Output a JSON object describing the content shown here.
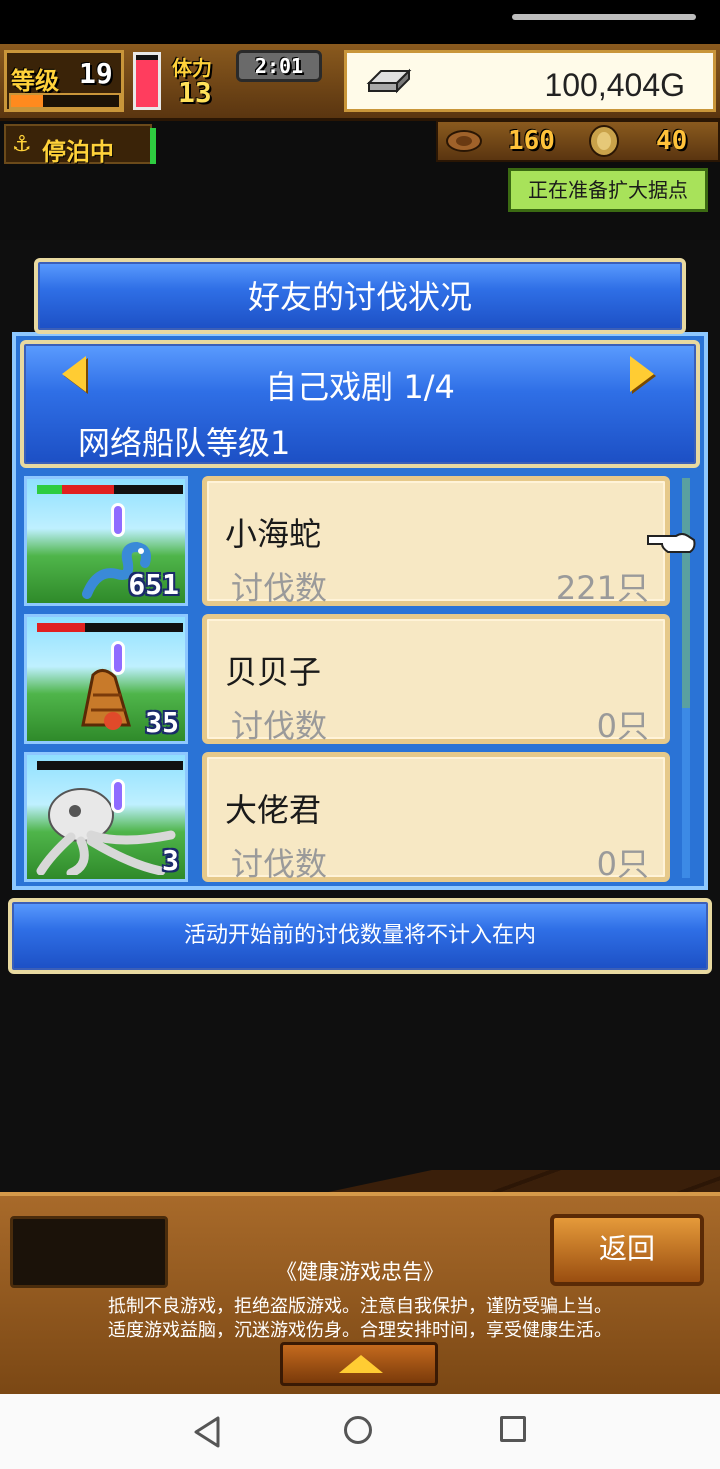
{
  "hud": {
    "level_label": "等级",
    "level_value": "19",
    "exp_fraction": 0.3,
    "stamina_label": "体力",
    "stamina_value": "13",
    "stamina_fraction": 0.9,
    "clock": "2:01",
    "gold": "100,404G"
  },
  "status": {
    "port_label": "停泊中",
    "food": "160",
    "resource2": "40",
    "expand_notice": "正在准备扩大据点"
  },
  "panel": {
    "title": "好友的讨伐状况",
    "play_title": "自己戏剧 1/4",
    "play_subtitle": "网络船队等级1",
    "rows": [
      {
        "name": "小海蛇",
        "count_label": "讨伐数",
        "count": "221只",
        "thumb_level": "651",
        "hp_green": 0.17,
        "hp_red": 0.36,
        "bg": "#64c8ea"
      },
      {
        "name": "贝贝子",
        "count_label": "讨伐数",
        "count": "0只",
        "thumb_level": "35",
        "hp_green": 0,
        "hp_red": 0.33,
        "bg": "#64c8ea"
      },
      {
        "name": "大佬君",
        "count_label": "讨伐数",
        "count": "0只",
        "thumb_level": "3",
        "hp_green": 0,
        "hp_red": 0,
        "bg": "#64c8ea"
      }
    ],
    "notice": "活动开始前的讨伐数量将不计入在内"
  },
  "bottom": {
    "back_label": "返回",
    "health_title": "《健康游戏忠告》",
    "health_line1": "抵制不良游戏，拒绝盗版游戏。注意自我保护，谨防受骗上当。",
    "health_line2": "适度游戏益脑，沉迷游戏伤身。合理安排时间，享受健康生活。"
  },
  "colors": {
    "panel_blue": "#2f6fe6",
    "card_bg": "#f7e8c4",
    "gold_accent": "#ffcc33"
  },
  "icons": [
    "anchor-icon",
    "silver-ingot-icon",
    "food-icon",
    "coin-icon",
    "left-arrow-icon",
    "right-arrow-icon",
    "pointer-hand-icon",
    "up-arrow-icon"
  ]
}
